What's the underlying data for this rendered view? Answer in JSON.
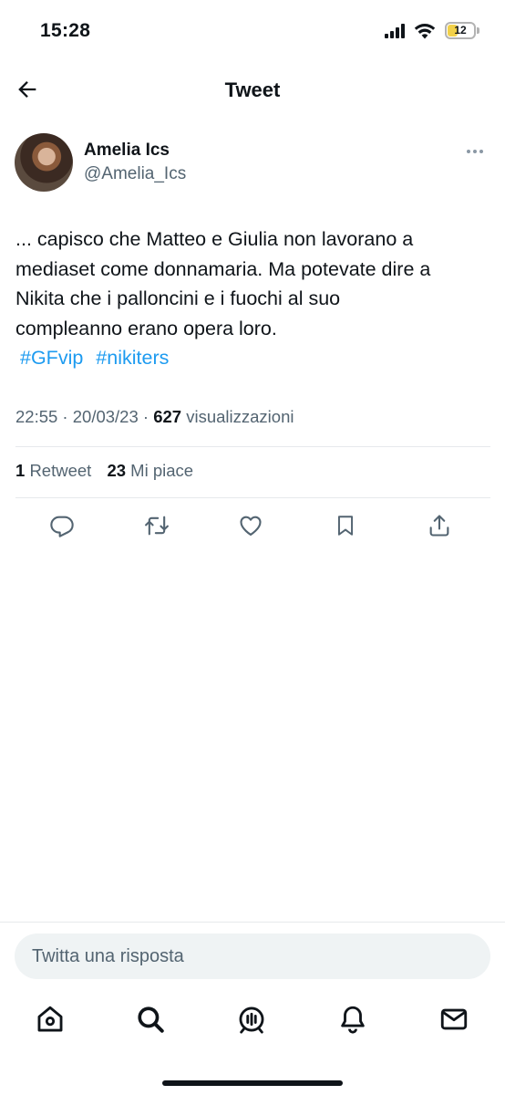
{
  "status_bar": {
    "time": "15:28",
    "battery": "12"
  },
  "header": {
    "title": "Tweet"
  },
  "author": {
    "name": "Amelia Ics",
    "handle": "@Amelia_Ics"
  },
  "tweet": {
    "lines": [
      "... capisco che Matteo e Giulia non lavorano a",
      "mediaset come donnamaria. Ma potevate dire a",
      "Nikita che i palloncini e i fuochi al suo",
      "compleanno erano opera loro."
    ],
    "hashtags": [
      "#GFvip",
      "#nikiters"
    ]
  },
  "meta": {
    "time": "22:55",
    "date": "20/03/23",
    "views_count": "627",
    "views_label": "visualizzazioni"
  },
  "stats": {
    "retweets_count": "1",
    "retweets_label": "Retweet",
    "likes_count": "23",
    "likes_label": "Mi piace"
  },
  "actions": [
    "reply-icon",
    "retweet-icon",
    "like-icon",
    "bookmark-icon",
    "share-icon"
  ],
  "reply": {
    "placeholder": "Twitta una risposta"
  },
  "tabs": [
    "home-icon",
    "search-icon",
    "spaces-icon",
    "notifications-icon",
    "messages-icon"
  ],
  "colors": {
    "accent": "#1d9bf0",
    "text": "#0f1419",
    "secondary": "#536471"
  }
}
